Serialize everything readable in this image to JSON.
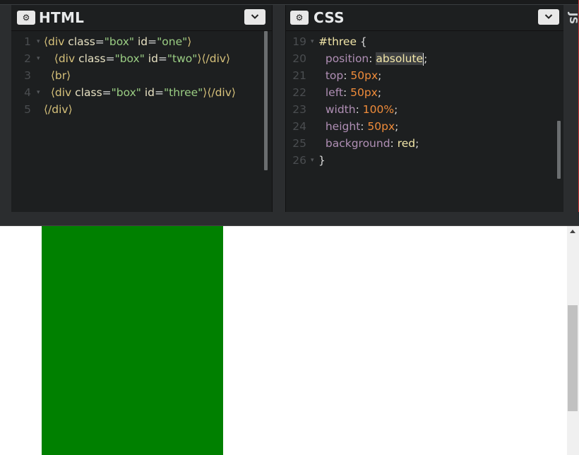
{
  "html_pane": {
    "title": "HTML",
    "lines": [
      {
        "num": "1",
        "fold": true,
        "indent": "",
        "tokens": [
          [
            "tag",
            "⟨div"
          ],
          [
            "attr",
            " class"
          ],
          [
            "punc",
            "="
          ],
          [
            "str",
            "\"box\""
          ],
          [
            "attr",
            " id"
          ],
          [
            "punc",
            "="
          ],
          [
            "str",
            "\"one\""
          ],
          [
            "tag",
            "⟩"
          ]
        ]
      },
      {
        "num": "2",
        "fold": true,
        "indent": "   ",
        "tokens": [
          [
            "tag",
            "⟨div"
          ],
          [
            "attr",
            " class"
          ],
          [
            "punc",
            "="
          ],
          [
            "str",
            "\"box\""
          ],
          [
            "attr",
            " id"
          ],
          [
            "punc",
            "="
          ],
          [
            "str",
            "\"two\""
          ],
          [
            "tag",
            "⟩⟨/div⟩"
          ]
        ]
      },
      {
        "num": "3",
        "fold": false,
        "indent": "  ",
        "tokens": [
          [
            "tag",
            "⟨br⟩"
          ]
        ]
      },
      {
        "num": "4",
        "fold": true,
        "indent": "  ",
        "tokens": [
          [
            "tag",
            "⟨div"
          ],
          [
            "attr",
            " class"
          ],
          [
            "punc",
            "="
          ],
          [
            "str",
            "\"box\""
          ],
          [
            "attr",
            " id"
          ],
          [
            "punc",
            "="
          ],
          [
            "str",
            "\"three\""
          ],
          [
            "tag",
            "⟩⟨/div⟩"
          ]
        ]
      },
      {
        "num": "5",
        "fold": false,
        "indent": "",
        "tokens": [
          [
            "tag",
            "⟨/div⟩"
          ]
        ]
      }
    ]
  },
  "css_pane": {
    "title": "CSS",
    "lines": [
      {
        "num": "19",
        "fold": true,
        "indent": "",
        "tokens": [
          [
            "sel",
            "#three"
          ],
          [
            "punc",
            " {"
          ]
        ]
      },
      {
        "num": "20",
        "fold": false,
        "indent": "  ",
        "tokens": [
          [
            "prop",
            "position"
          ],
          [
            "punc",
            ": "
          ],
          [
            "kwhl",
            "absolute"
          ],
          [
            "cursor",
            ""
          ],
          [
            "punc",
            ";"
          ]
        ]
      },
      {
        "num": "21",
        "fold": false,
        "indent": "  ",
        "tokens": [
          [
            "prop",
            "top"
          ],
          [
            "punc",
            ": "
          ],
          [
            "val",
            "50px"
          ],
          [
            "punc",
            ";"
          ]
        ]
      },
      {
        "num": "22",
        "fold": false,
        "indent": "  ",
        "tokens": [
          [
            "prop",
            "left"
          ],
          [
            "punc",
            ": "
          ],
          [
            "val",
            "50px"
          ],
          [
            "punc",
            ";"
          ]
        ]
      },
      {
        "num": "23",
        "fold": false,
        "indent": "  ",
        "tokens": [
          [
            "prop",
            "width"
          ],
          [
            "punc",
            ": "
          ],
          [
            "val",
            "100%"
          ],
          [
            "punc",
            ";"
          ]
        ]
      },
      {
        "num": "24",
        "fold": false,
        "indent": "  ",
        "tokens": [
          [
            "prop",
            "height"
          ],
          [
            "punc",
            ": "
          ],
          [
            "val",
            "50px"
          ],
          [
            "punc",
            ";"
          ]
        ]
      },
      {
        "num": "25",
        "fold": false,
        "indent": "  ",
        "tokens": [
          [
            "prop",
            "background"
          ],
          [
            "punc",
            ": "
          ],
          [
            "kw",
            "red"
          ],
          [
            "punc",
            ";"
          ]
        ]
      },
      {
        "num": "26",
        "fold": true,
        "indent": "",
        "tokens": [
          [
            "punc",
            "}"
          ]
        ]
      }
    ]
  },
  "js_pane": {
    "title": "JS"
  },
  "preview": {
    "box_color": "#008000"
  },
  "icons": {
    "gear": "gear-icon",
    "chevron": "chevron-down-icon"
  }
}
